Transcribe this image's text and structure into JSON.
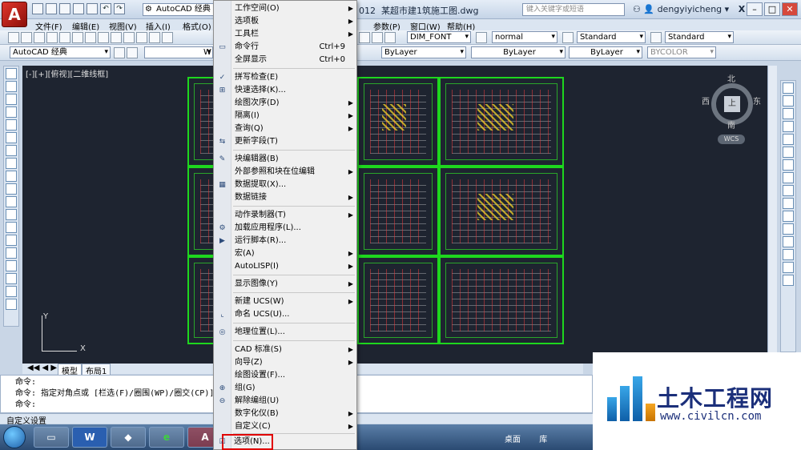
{
  "titlebar": {
    "app_logo": "A",
    "workspace": "AutoCAD 经典",
    "doc_title_prefix": "012",
    "doc_title": "某超市建1筑施工图.dwg",
    "search_placeholder": "键入关键字或短语",
    "user": "dengyiyicheng"
  },
  "menubar": {
    "items": [
      "文件(F)",
      "编辑(E)",
      "视图(V)",
      "插入(I)",
      "格式(O)",
      "参数(P)",
      "窗口(W)",
      "帮助(H)"
    ]
  },
  "toolbar": {
    "text_style": "DIM_FONT",
    "dim_style": "normal",
    "table_style": "Standard",
    "multileader_style": "Standard",
    "workspace2": "AutoCAD 经典",
    "layer_prefix": "W",
    "color": "ByLayer",
    "linetype": "ByLayer",
    "lineweight": "ByLayer",
    "plotstyle": "BYCOLOR"
  },
  "canvas": {
    "view_label": "[-][+][俯视][二维线框]",
    "compass": {
      "n": "北",
      "s": "南",
      "e": "东",
      "w": "西",
      "top": "上",
      "wcs": "WCS"
    },
    "ucs_x": "X",
    "ucs_y": "Y"
  },
  "tabs": [
    "模型",
    "布局1"
  ],
  "command": {
    "line1": "命令:",
    "line2": "命令: 指定对角点或 [栏选(F)/圈围(WP)/圈交(CP)]:",
    "line3": "命令:"
  },
  "status_text": "自定义设置",
  "taskbar": {
    "apps": [
      "W",
      "e",
      "A"
    ],
    "tray_text": "桌面",
    "tray_text2": "库"
  },
  "watermark": {
    "cn": "土木工程网",
    "url": "www.civilcn.com"
  },
  "menu": {
    "items": [
      {
        "label": "工作空间(O)",
        "arrow": true
      },
      {
        "label": "选项板",
        "arrow": true
      },
      {
        "label": "工具栏",
        "arrow": true
      },
      {
        "label": "命令行",
        "shortcut": "Ctrl+9"
      },
      {
        "label": "全屏显示",
        "shortcut": "Ctrl+0"
      },
      {
        "label": "拼写检查(E)"
      },
      {
        "label": "快速选择(K)..."
      },
      {
        "label": "绘图次序(D)",
        "arrow": true
      },
      {
        "label": "隔离(I)",
        "arrow": true
      },
      {
        "label": "查询(Q)",
        "arrow": true
      },
      {
        "label": "更新字段(T)"
      },
      {
        "label": "块编辑器(B)"
      },
      {
        "label": "外部参照和块在位编辑",
        "arrow": true
      },
      {
        "label": "数据提取(X)..."
      },
      {
        "label": "数据链接",
        "arrow": true
      },
      {
        "label": "动作录制器(T)",
        "arrow": true
      },
      {
        "label": "加载应用程序(L)..."
      },
      {
        "label": "运行脚本(R)..."
      },
      {
        "label": "宏(A)",
        "arrow": true
      },
      {
        "label": "AutoLISP(I)",
        "arrow": true
      },
      {
        "label": "显示图像(Y)",
        "arrow": true
      },
      {
        "label": "新建 UCS(W)",
        "arrow": true
      },
      {
        "label": "命名 UCS(U)..."
      },
      {
        "label": "地理位置(L)..."
      },
      {
        "label": "CAD 标准(S)",
        "arrow": true
      },
      {
        "label": "向导(Z)",
        "arrow": true
      },
      {
        "label": "绘图设置(F)..."
      },
      {
        "label": "组(G)"
      },
      {
        "label": "解除编组(U)"
      },
      {
        "label": "数字化仪(B)",
        "arrow": true
      },
      {
        "label": "自定义(C)",
        "arrow": true
      },
      {
        "label": "选项(N)..."
      }
    ]
  },
  "icons": {
    "workspace": "gear-icon",
    "search": "search-icon",
    "binoculars": "binoculars-icon",
    "user": "user-icon",
    "exchange": "exchange-icon",
    "star": "star-icon",
    "help": "help-icon"
  }
}
